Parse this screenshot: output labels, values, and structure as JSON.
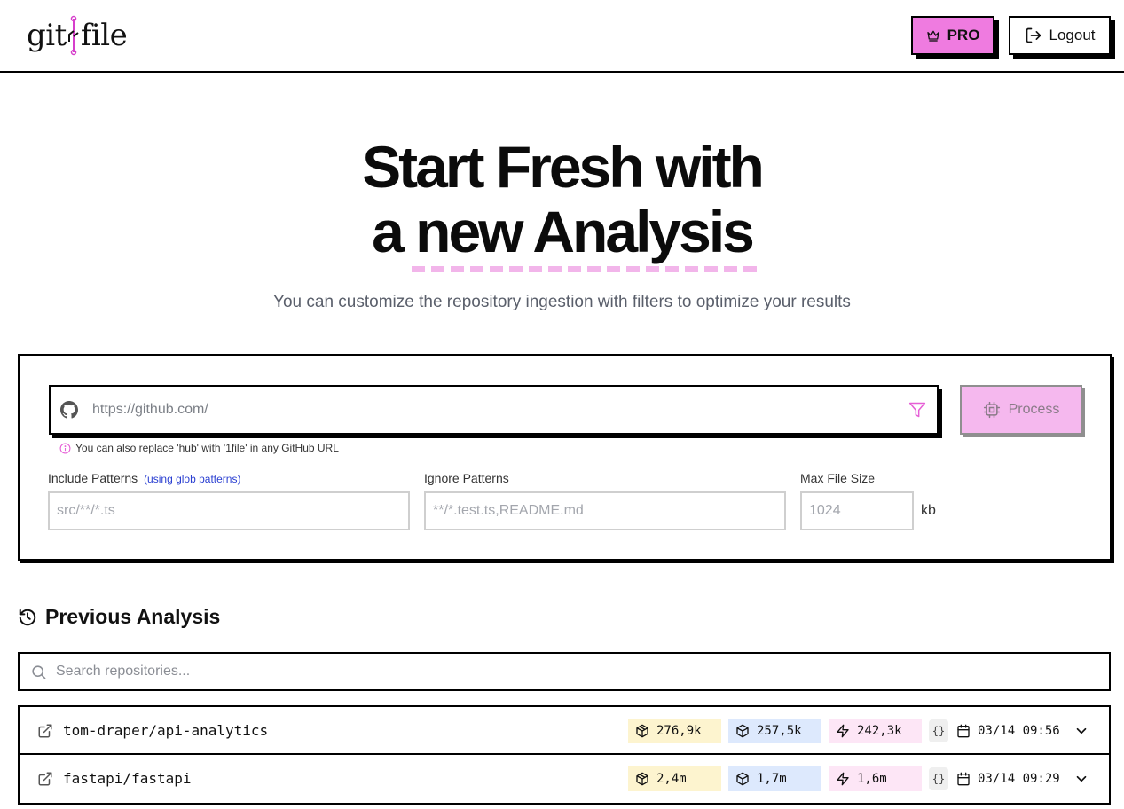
{
  "header": {
    "logo_left": "git",
    "logo_right": "file",
    "pro_label": "PRO",
    "logout_label": "Logout"
  },
  "hero": {
    "title_line1": "Start Fresh with",
    "title_line2": "a new Analysis",
    "subtitle": "You can customize the repository ingestion with filters to optimize your results"
  },
  "form": {
    "url_placeholder": "https://github.com/",
    "process_label": "Process",
    "hint": "You can also replace 'hub' with '1file' in any GitHub URL",
    "include_label": "Include Patterns",
    "include_glob": "(using glob patterns)",
    "include_placeholder": "src/**/*.ts",
    "ignore_label": "Ignore Patterns",
    "ignore_placeholder": "**/*.test.ts,README.md",
    "maxsize_label": "Max File Size",
    "maxsize_placeholder": "1024",
    "maxsize_unit": "kb"
  },
  "previous": {
    "title": "Previous Analysis",
    "search_placeholder": "Search repositories...",
    "repos": [
      {
        "name": "tom-draper/api-analytics",
        "stat1": "276,9k",
        "stat2": "257,5k",
        "stat3": "242,3k",
        "format": "{}",
        "date": "03/14 09:56"
      },
      {
        "name": "fastapi/fastapi",
        "stat1": "2,4m",
        "stat2": "1,7m",
        "stat3": "1,6m",
        "format": "{}",
        "date": "03/14 09:29"
      }
    ]
  },
  "colors": {
    "accent_pink": "#ef7be0",
    "process_pink": "#f5b8ee",
    "badge_yellow": "#fdf4cf",
    "badge_blue": "#dde9fd",
    "badge_pink": "#fde6f6",
    "link_blue": "#2a3fd1"
  },
  "icons": {
    "pro": "crown-icon",
    "logout": "logout-icon",
    "url": "github-icon",
    "filter": "filter-icon",
    "process": "cpu-icon",
    "hint": "info-icon",
    "history": "history-icon",
    "search": "search-icon",
    "external": "external-link-icon",
    "stat1": "boxes-icon",
    "stat2": "box-icon",
    "stat3": "zap-icon",
    "date": "calendar-icon",
    "expand": "chevron-down-icon"
  }
}
